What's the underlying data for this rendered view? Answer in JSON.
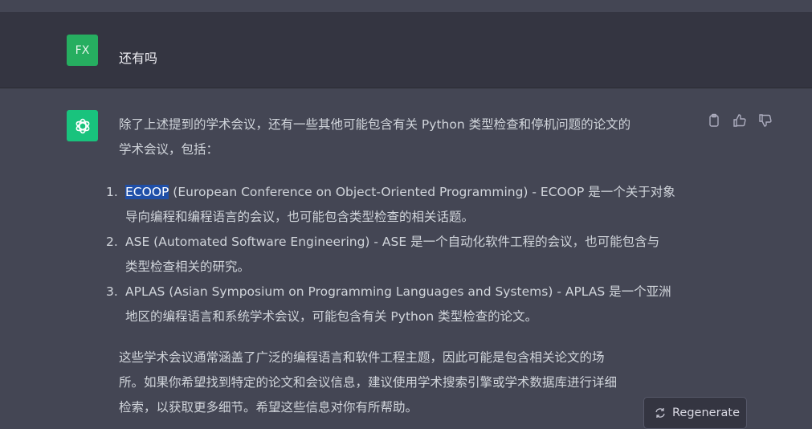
{
  "user": {
    "initials": "FX",
    "message": "还有吗"
  },
  "assistant": {
    "intro_lines": [
      "除了上述提到的学术会议，还有一些其他可能包含有关 Python 类型检查和停机问题的论文的",
      "学术会议，包括："
    ],
    "items": [
      {
        "num": "1.",
        "highlight": "ECOOP",
        "lines": [
          " (European Conference on Object-Oriented Programming) - ECOOP 是一个关于对象",
          "导向编程和编程语言的会议，也可能包含类型检查的相关话题。"
        ]
      },
      {
        "num": "2.",
        "highlight": "",
        "lines": [
          "ASE (Automated Software Engineering) - ASE 是一个自动化软件工程的会议，也可能包含与",
          "类型检查相关的研究。"
        ]
      },
      {
        "num": "3.",
        "highlight": "",
        "lines": [
          "APLAS (Asian Symposium on Programming Languages and Systems) - APLAS 是一个亚洲",
          "地区的编程语言和系统学术会议，可能包含有关 Python 类型检查的论文。"
        ]
      }
    ],
    "outro_lines": [
      "这些学术会议通常涵盖了广泛的编程语言和软件工程主题，因此可能是包含相关论文的场",
      "所。如果你希望找到特定的论文和会议信息，建议使用学术搜索引擎或学术数据库进行详细",
      "检索，以获取更多细节。希望这些信息对你有所帮助。"
    ]
  },
  "regenerate_label": "Regenerate",
  "colors": {
    "user_bg": "#343541",
    "assistant_bg": "#444654",
    "user_avatar": "#26ae60",
    "bot_avatar": "#19c37d"
  }
}
